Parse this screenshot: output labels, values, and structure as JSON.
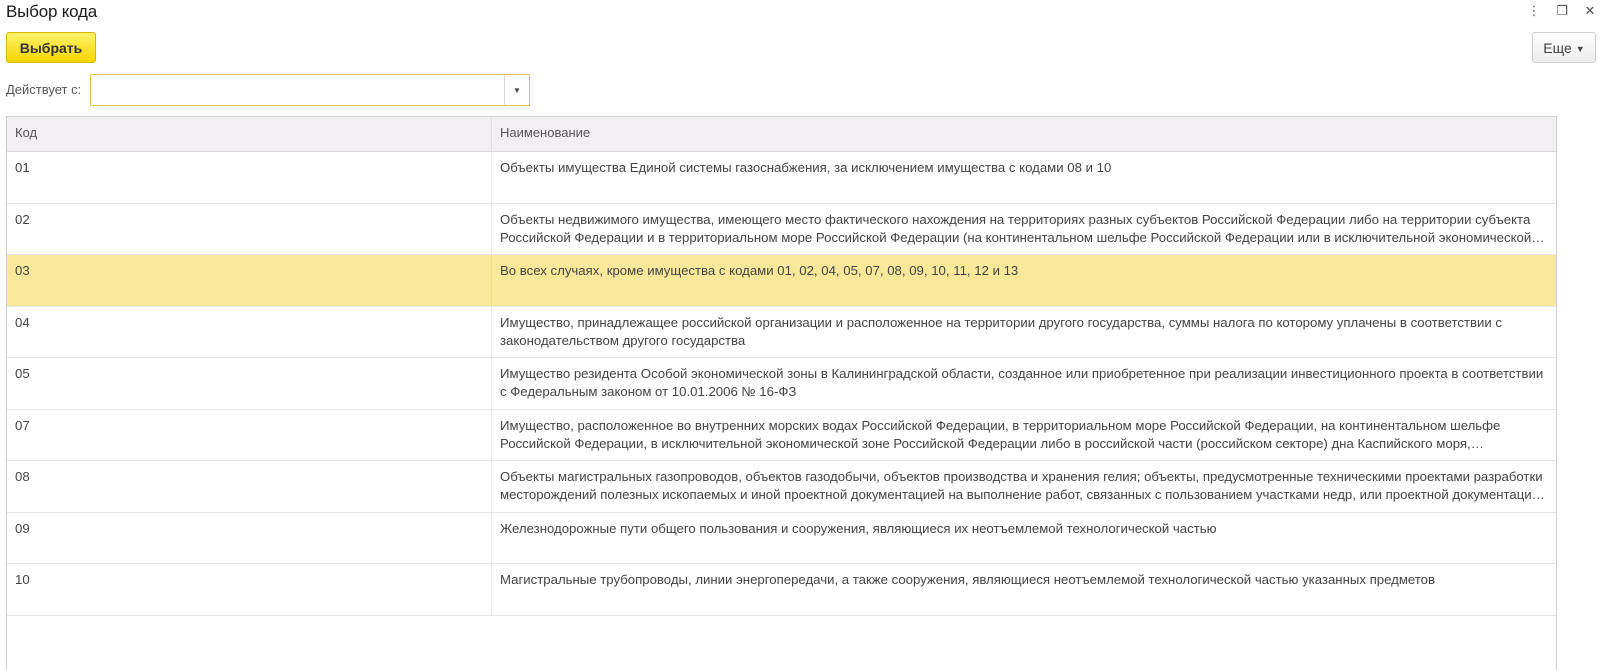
{
  "window": {
    "title": "Выбор кода",
    "controls": {
      "menu": "⋮",
      "restore": "❐",
      "close": "✕"
    }
  },
  "toolbar": {
    "select_label": "Выбрать",
    "more_label": "Еще",
    "more_caret": "▼"
  },
  "filter": {
    "label": "Действует с:",
    "value": "",
    "dropdown_glyph": "▼"
  },
  "table": {
    "columns": [
      "Код",
      "Наименование"
    ],
    "selected_index": 2,
    "rows": [
      {
        "code": "01",
        "name": "Объекты имущества Единой системы газоснабжения, за исключением имущества с кодами 08 и 10"
      },
      {
        "code": "02",
        "name": "Объекты недвижимого имущества, имеющего место фактического нахождения на территориях разных субъектов Российской Федерации либо на территории субъекта Российской Федерации и в территориальном море Российской Федерации (на континентальном шельфе Российской Федерации или в исключительной экономической зоне Российской Федерации)"
      },
      {
        "code": "03",
        "name": "Во всех случаях, кроме имущества с кодами 01, 02, 04, 05, 07, 08, 09, 10, 11, 12 и 13"
      },
      {
        "code": "04",
        "name": "Имущество, принадлежащее российской организации и расположенное на территории другого государства, суммы налога по которому уплачены в соответствии с законодательством другого государства"
      },
      {
        "code": "05",
        "name": "Имущество резидента Особой экономической зоны в Калининградской области, созданное или приобретенное при реализации инвестиционного проекта в соответствии с Федеральным законом от 10.01.2006 № 16-ФЗ"
      },
      {
        "code": "07",
        "name": "Имущество, расположенное во внутренних морских водах Российской Федерации, в территориальном море Российской Федерации, на континентальном шельфе Российской Федерации, в исключительной экономической зоне Российской Федерации либо в российской части (российском секторе) дна Каспийского моря, используемое при разработке морских месторождений углеводородного сырья"
      },
      {
        "code": "08",
        "name": "Объекты магистральных газопроводов, объектов газодобычи, объектов производства и хранения гелия; объекты, предусмотренные техническими проектами разработки месторождений полезных ископаемых и иной проектной документацией на выполнение работ, связанных с пользованием участками недр, или проектной документацией объектов капитального строительства"
      },
      {
        "code": "09",
        "name": "Железнодорожные пути общего пользования и сооружения, являющиеся их неотъемлемой технологической частью"
      },
      {
        "code": "10",
        "name": "Магистральные трубопроводы, линии энергопередачи, а также сооружения, являющиеся неотъемлемой технологической частью указанных предметов"
      }
    ]
  }
}
